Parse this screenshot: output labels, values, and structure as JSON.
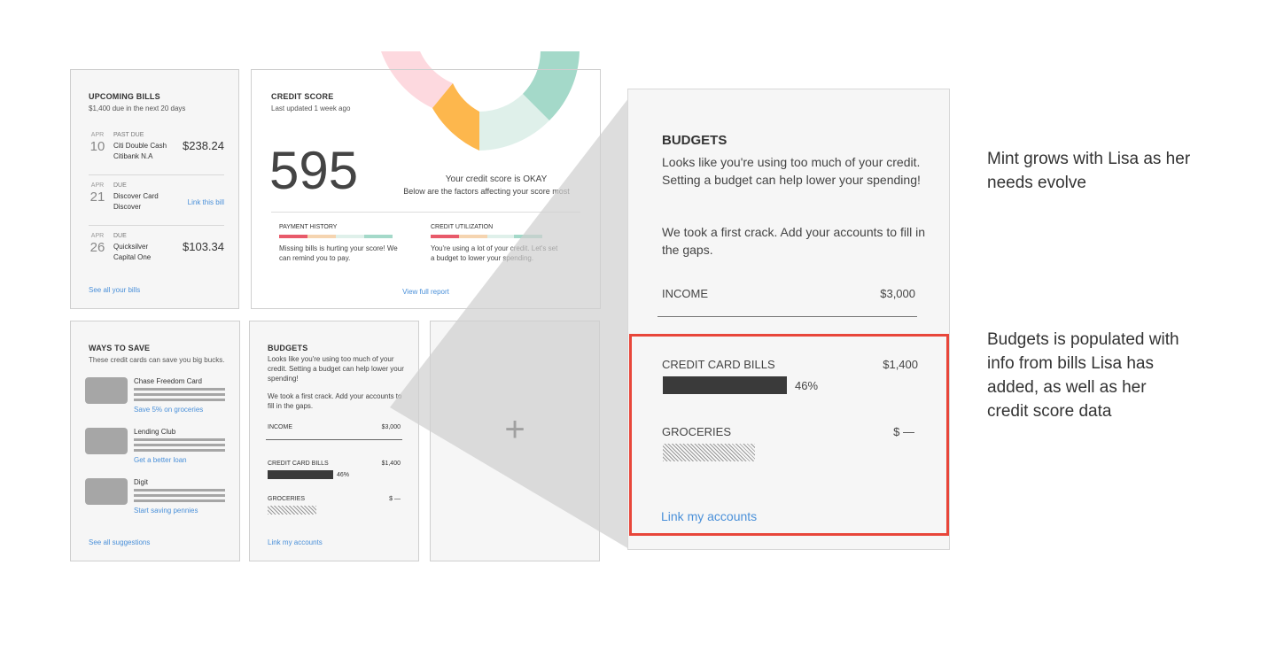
{
  "bills": {
    "title": "UPCOMING BILLS",
    "subtitle": "$1,400 due in the next 20 days",
    "items": [
      {
        "month": "APR",
        "day": "10",
        "status": "PAST DUE",
        "name": "Citi Double Cash",
        "issuer": "Citibank N.A",
        "amount": "$238.24"
      },
      {
        "month": "APR",
        "day": "21",
        "status": "DUE",
        "name": "Discover Card",
        "issuer": "Discover",
        "link": "Link this bill"
      },
      {
        "month": "APR",
        "day": "26",
        "status": "DUE",
        "name": "Quicksilver",
        "issuer": "Capital One",
        "amount": "$103.34"
      }
    ],
    "footer_link": "See all your bills"
  },
  "credit": {
    "title": "CREDIT SCORE",
    "subtitle": "Last updated 1 week ago",
    "score": "595",
    "status": "Your credit score is OKAY",
    "status_sub": "Below are the factors affecting your score most",
    "factors": [
      {
        "label": "PAYMENT HISTORY",
        "text": "Missing bills is hurting your score! We can remind you to pay."
      },
      {
        "label": "CREDIT UTILIZATION",
        "text": "You're using a lot of your credit. Let's set a budget to lower your spending."
      }
    ],
    "footer_link": "View full report"
  },
  "save": {
    "title": "WAYS TO SAVE",
    "subtitle": "These credit cards can save you big bucks.",
    "items": [
      {
        "name": "Chase Freedom Card",
        "link": "Save 5% on groceries"
      },
      {
        "name": "Lending Club",
        "link": "Get a better loan"
      },
      {
        "name": "Digit",
        "link": "Start saving pennies"
      }
    ],
    "footer_link": "See all suggestions"
  },
  "budgets": {
    "title": "BUDGETS",
    "intro": "Looks like you're using too much of your credit. Setting a budget can help lower your spending!",
    "intro2": "We took a first crack. Add your accounts to fill in the gaps.",
    "income_label": "INCOME",
    "income_value": "$3,000",
    "cc_label": "CREDIT CARD BILLS",
    "cc_value": "$1,400",
    "cc_pct": "46%",
    "cc_fraction": 0.46,
    "groceries_label": "GROCERIES",
    "groceries_value": "$ —",
    "link": "Link my accounts"
  },
  "add_tile": {
    "glyph": "+"
  },
  "notes": {
    "note1": "Mint grows with Lisa as her needs evolve",
    "note2": "Budgets is populated with info from bills Lisa has added, as well as her credit score data"
  },
  "colors": {
    "accent_link": "#4a90d9",
    "highlight_border": "#e8463a",
    "bar_dark": "#3a3a3a",
    "bar_red": "#e85a6a",
    "bar_peach": "#f5d4b0",
    "bar_mint": "#cfe9df",
    "bar_teal": "#a4d9c9"
  }
}
